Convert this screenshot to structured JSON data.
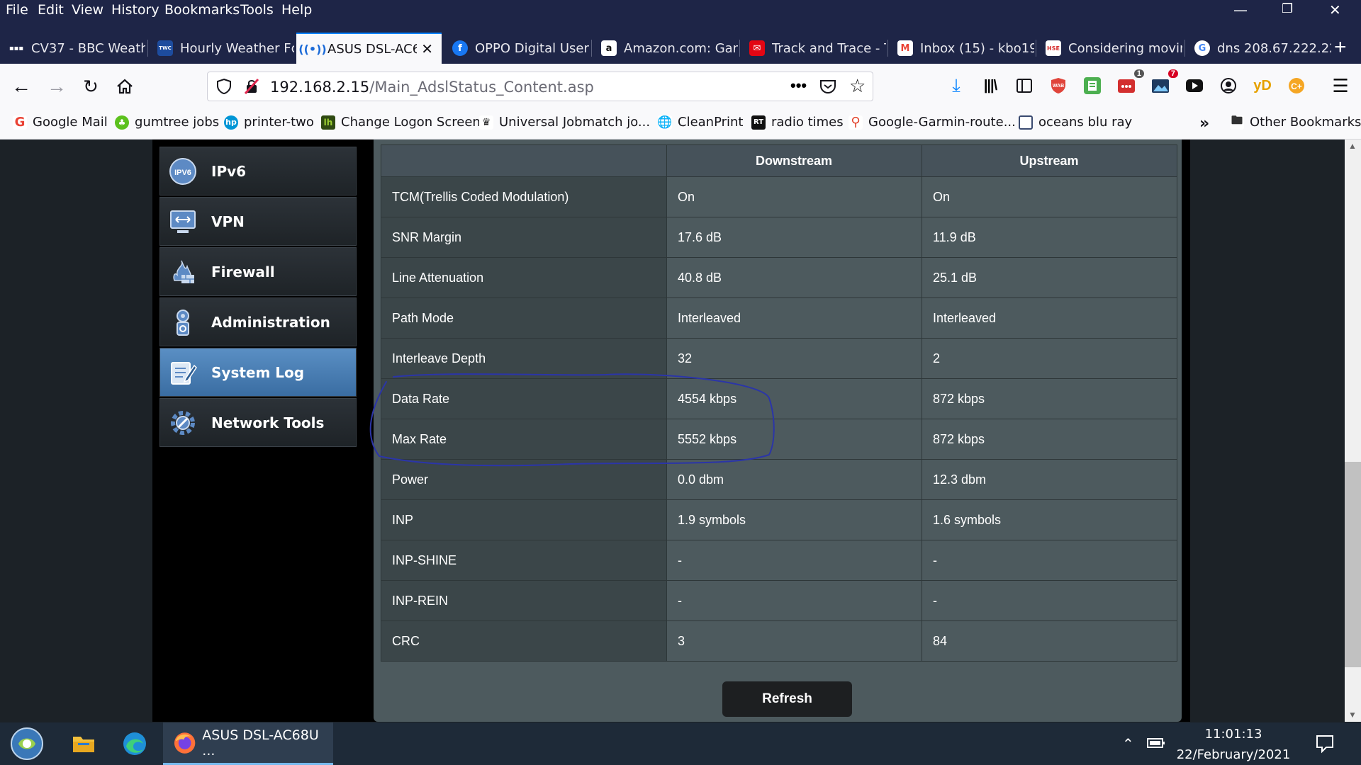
{
  "menubar": {
    "items": [
      "File",
      "Edit",
      "View",
      "History",
      "Bookmarks",
      "Tools",
      "Help"
    ]
  },
  "tabs": [
    {
      "label": "CV37 - BBC Weath",
      "icon": "bbc-icon"
    },
    {
      "label": "Hourly Weather Fc",
      "icon": "weather-channel-icon"
    },
    {
      "label": "ASUS DSL-AC6",
      "icon": "router-wireless-icon",
      "active": true
    },
    {
      "label": "OPPO Digital User",
      "icon": "facebook-icon"
    },
    {
      "label": "Amazon.com: Gan",
      "icon": "amazon-icon"
    },
    {
      "label": "Track and Trace - T",
      "icon": "royal-mail-icon"
    },
    {
      "label": "Inbox (15) - kbo19",
      "icon": "gmail-icon"
    },
    {
      "label": "Considering movin",
      "icon": "hse-icon"
    },
    {
      "label": "dns 208.67.222.22",
      "icon": "google-icon"
    }
  ],
  "address": {
    "host": "192.168.2.15",
    "path": "/Main_AdslStatus_Content.asp"
  },
  "toolbar": {
    "badge_one": "1",
    "badge_seven": "7",
    "yd_label": "yD"
  },
  "bookmarks": [
    {
      "label": "Google Mail",
      "icon": "google-icon",
      "color": "#ea4335"
    },
    {
      "label": "gumtree jobs",
      "icon": "gumtree-icon",
      "color": "#5cc11d"
    },
    {
      "label": "printer-two",
      "icon": "hp-icon",
      "color": "#0096d6"
    },
    {
      "label": "Change Logon Screen",
      "icon": "lh-icon",
      "color": "#3a5a1a"
    },
    {
      "label": "Universal Jobmatch jo...",
      "icon": "crown-icon",
      "color": "#222222"
    },
    {
      "label": "CleanPrint",
      "icon": "globe-icon",
      "color": "#555555"
    },
    {
      "label": "radio times",
      "icon": "rt-icon",
      "color": "#111111"
    },
    {
      "label": "Google-Garmin-route...",
      "icon": "map-pin-icon",
      "color": "#e2412a"
    },
    {
      "label": "oceans blu ray",
      "icon": "page-icon",
      "color": "#3a4a70"
    }
  ],
  "bookmarks_other": "Other Bookmarks",
  "sidebar": {
    "items": [
      {
        "label": "IPv6",
        "icon": "ipv6-icon"
      },
      {
        "label": "VPN",
        "icon": "vpn-icon"
      },
      {
        "label": "Firewall",
        "icon": "firewall-icon"
      },
      {
        "label": "Administration",
        "icon": "administration-icon"
      },
      {
        "label": "System Log",
        "icon": "system-log-icon",
        "active": true
      },
      {
        "label": "Network Tools",
        "icon": "network-tools-icon"
      }
    ]
  },
  "table": {
    "headers": [
      "",
      "Downstream",
      "Upstream"
    ],
    "rows": [
      [
        "TCM(Trellis Coded Modulation)",
        "On",
        "On"
      ],
      [
        "SNR Margin",
        "17.6 dB",
        "11.9 dB"
      ],
      [
        "Line Attenuation",
        "40.8 dB",
        "25.1 dB"
      ],
      [
        "Path Mode",
        "Interleaved",
        "Interleaved"
      ],
      [
        "Interleave Depth",
        "32",
        "2"
      ],
      [
        "Data Rate",
        "4554 kbps",
        "872 kbps"
      ],
      [
        "Max Rate",
        "5552 kbps",
        "872 kbps"
      ],
      [
        "Power",
        "0.0 dbm",
        "12.3 dbm"
      ],
      [
        "INP",
        "1.9 symbols",
        "1.6 symbols"
      ],
      [
        "INP-SHINE",
        "-",
        "-"
      ],
      [
        "INP-REIN",
        "-",
        "-"
      ],
      [
        "CRC",
        "3",
        "84"
      ]
    ]
  },
  "refresh_label": "Refresh",
  "taskbar": {
    "firefox_label": "ASUS DSL-AC68U ...",
    "time": "11:01:13",
    "date": "22/February/2021"
  },
  "colors": {
    "accent": "#0a84ff",
    "annotation_stroke": "#2b35a8",
    "active_sidebar": "#4a7eb4"
  }
}
